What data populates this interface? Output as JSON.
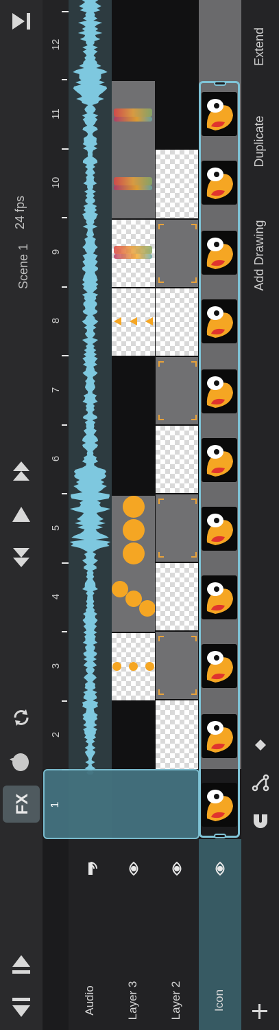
{
  "toolbar": {
    "fx_label": "FX",
    "icons": [
      "play-end-icon",
      "onion-skin-icon",
      "loop-icon",
      "next-keyframe-icon",
      "play-icon",
      "prev-keyframe-icon",
      "collapse-up-icon",
      "collapse-down-icon"
    ]
  },
  "header": {
    "scene": "Scene 1",
    "fps": "24 fps"
  },
  "ruler": {
    "labels": [
      "2",
      "3",
      "4",
      "5",
      "6",
      "7",
      "8",
      "9",
      "10",
      "11",
      "12"
    ],
    "frame_badge": "1"
  },
  "layers": [
    {
      "name": "Audio",
      "icon": "audio-icon"
    },
    {
      "name": "Layer 3",
      "icon": "eye-icon"
    },
    {
      "name": "Layer 2",
      "icon": "eye-icon"
    },
    {
      "name": "Icon",
      "icon": "eye-icon"
    }
  ],
  "right_rail": {
    "actions": [
      "Extend",
      "Duplicate",
      "Add Drawing"
    ],
    "icons": [
      "diamond-icon",
      "branch-icon",
      "magnet-icon",
      "add-layer-icon"
    ],
    "add_symbol": "+"
  },
  "colors": {
    "accent": "#7fc3d6",
    "waveform": "#7ec8df",
    "orange": "#f5a623"
  }
}
